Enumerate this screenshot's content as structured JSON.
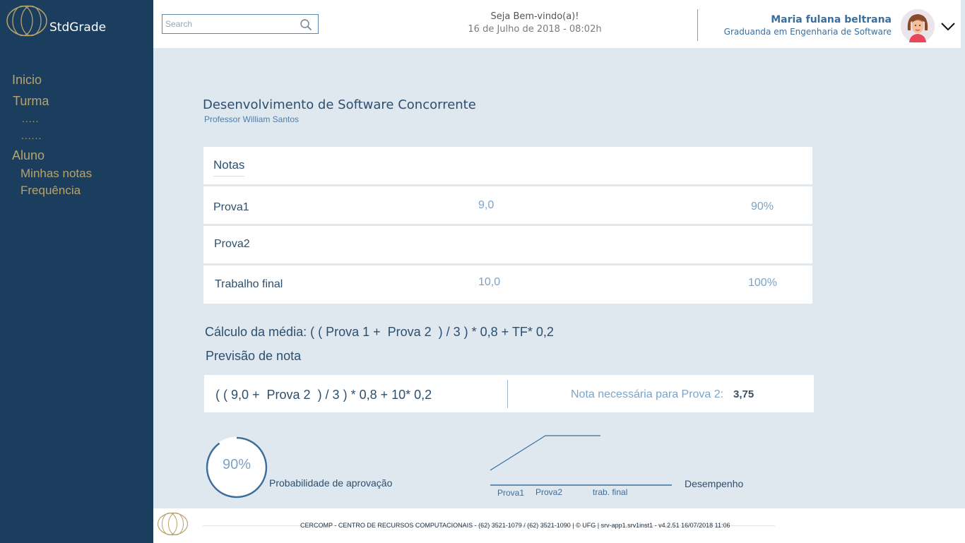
{
  "app": {
    "brand": "StdGrade"
  },
  "sidebar": {
    "items": [
      {
        "label": "Inicio"
      },
      {
        "label": "Turma"
      },
      {
        "label": "....."
      },
      {
        "label": "......"
      },
      {
        "label": "Aluno"
      },
      {
        "label": "Minhas notas"
      },
      {
        "label": "Frequência"
      }
    ]
  },
  "header": {
    "search_placeholder": "Search",
    "welcome": "Seja Bem-vindo(a)!",
    "date": "16 de Julho de 2018 - 08:02h",
    "user_name": "Maria fulana beltrana",
    "user_role": "Graduanda em Engenharia de Software"
  },
  "course": {
    "title": "Desenvolvimento de Software Concorrente",
    "professor": "Professor William Santos"
  },
  "grades": {
    "title": "Notas",
    "rows": [
      {
        "label": "Prova1",
        "value": "9,0",
        "percent": "90%"
      },
      {
        "label": "Prova2",
        "value": "",
        "percent": ""
      },
      {
        "label": "Trabalho final",
        "value": "10,0",
        "percent": "100%"
      }
    ]
  },
  "calculation": {
    "formula": "Cálculo da média: ( ( Prova 1 +  Prova 2  ) / 3 ) * 0,8 + TF* 0,2"
  },
  "prediction": {
    "title": "Previsão de nota",
    "formula": "( ( 9,0 +  Prova 2  ) / 3 ) * 0,8 + 10* 0,2",
    "needed_label": "Nota necessária para Prova 2:",
    "needed_value": "3,75"
  },
  "approval": {
    "percent_label": "90%",
    "percent": 90,
    "label": "Probabilidade de aprovação"
  },
  "performance": {
    "title": "Desempenho",
    "categories": [
      "Prova1",
      "Prova2",
      "trab. final"
    ]
  },
  "footer": {
    "text": "CERCOMP - CENTRO DE RECURSOS COMPUTACIONAIS - (62) 3521-1079 / (62) 3521-1090 | © UFG | srv-app1.srv1inst1 - v4.2.51 16/07/2018 11:06"
  },
  "colors": {
    "sidebar_bg": "#1c3e5e",
    "nav_text": "#b6a36b",
    "page_bg": "#dfe7ef",
    "accent": "#3c6e9c",
    "muted_value": "#7da3c6"
  }
}
